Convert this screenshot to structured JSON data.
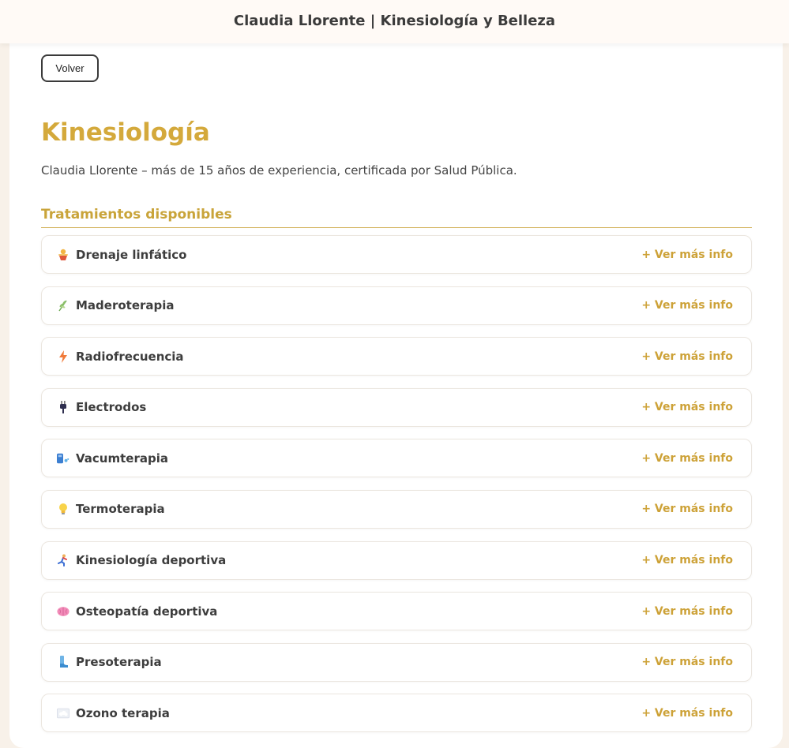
{
  "header": {
    "title": "Claudia Llorente | Kinesiología y Belleza"
  },
  "back_button": {
    "label": "Volver"
  },
  "page": {
    "title": "Kinesiología",
    "subtitle": "Claudia Llorente – más de 15 años de experiencia, certificada por Salud Pública."
  },
  "treatments": {
    "heading": "Tratamientos disponibles",
    "more_label": "+ Ver más info",
    "items": [
      {
        "label": "Drenaje linfático",
        "icon": "massage-icon"
      },
      {
        "label": "Maderoterapia",
        "icon": "herb-icon"
      },
      {
        "label": "Radiofrecuencia",
        "icon": "lightning-icon"
      },
      {
        "label": "Electrodos",
        "icon": "plug-icon"
      },
      {
        "label": "Vacumterapia",
        "icon": "vacuum-icon"
      },
      {
        "label": "Termoterapia",
        "icon": "lightbulb-icon"
      },
      {
        "label": "Kinesiología deportiva",
        "icon": "runner-icon"
      },
      {
        "label": "Osteopatía deportiva",
        "icon": "brain-icon"
      },
      {
        "label": "Presoterapia",
        "icon": "boot-icon"
      },
      {
        "label": "Ozono terapia",
        "icon": "cloud-icon"
      }
    ]
  }
}
